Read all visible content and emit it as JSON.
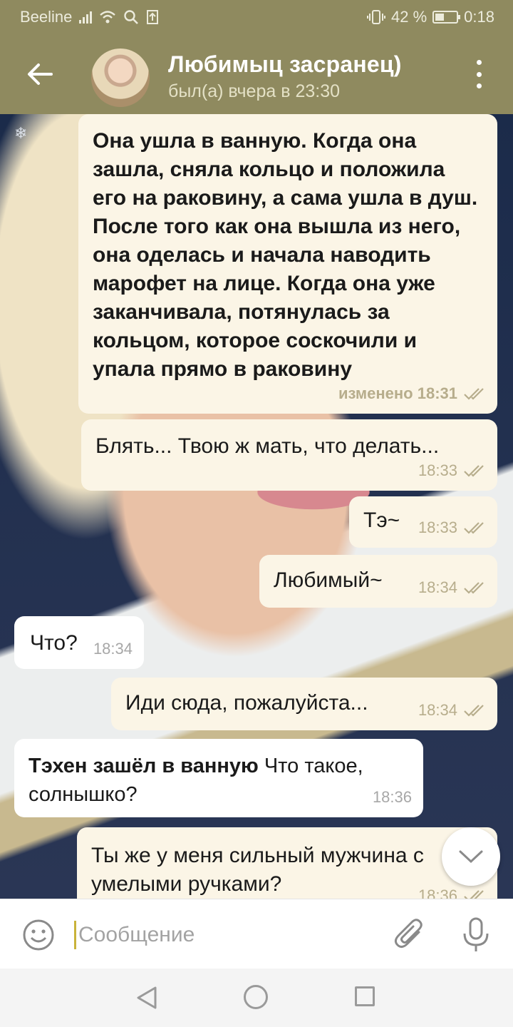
{
  "status_bar": {
    "carrier": "Beeline",
    "battery": "42 %",
    "battery_level": 0.42,
    "time": "0:18"
  },
  "header": {
    "contact_name": "Любимыц засранец)",
    "last_seen": "был(а) вчера в 23:30",
    "icons": {
      "back": "arrow-left-icon",
      "menu": "more-vertical-icon"
    }
  },
  "messages": [
    {
      "direction": "out",
      "text": "Она ушла в ванную. Когда она зашла, сняла кольцо и положила его на раковину, а сама ушла в душ. После того как она вышла из него, она оделась и начала наводить марофет на лице. Когда она уже заканчивала, потянулась за кольцом, которое соскочили и упала прямо в раковину",
      "time": "изменено 18:31",
      "read": true
    },
    {
      "direction": "out",
      "text": "Блять... Твою ж мать, что делать...",
      "time": "18:33",
      "read": true
    },
    {
      "direction": "out",
      "text": "Тэ~",
      "time": "18:33",
      "read": true
    },
    {
      "direction": "out",
      "text": "Любимый~",
      "time": "18:34",
      "read": true
    },
    {
      "direction": "in",
      "text": "Что?",
      "time": "18:34"
    },
    {
      "direction": "out",
      "text": "Иди сюда, пожалуйста...",
      "time": "18:34",
      "read": true
    },
    {
      "direction": "in",
      "bold_prefix": "Тэхен зашёл в ванную",
      "text": "Что такое, солнышко?",
      "time": "18:36"
    },
    {
      "direction": "out",
      "text": "Ты же у меня сильный мужчина с умелыми ручками?",
      "time": "18:36",
      "read": true
    }
  ],
  "input": {
    "placeholder": "Сообщение",
    "value": ""
  },
  "colors": {
    "header": "#8f8a5f",
    "bubble_out": "#fbf5e6",
    "bubble_in": "#ffffff",
    "check_marks": "#b7ad8c"
  }
}
